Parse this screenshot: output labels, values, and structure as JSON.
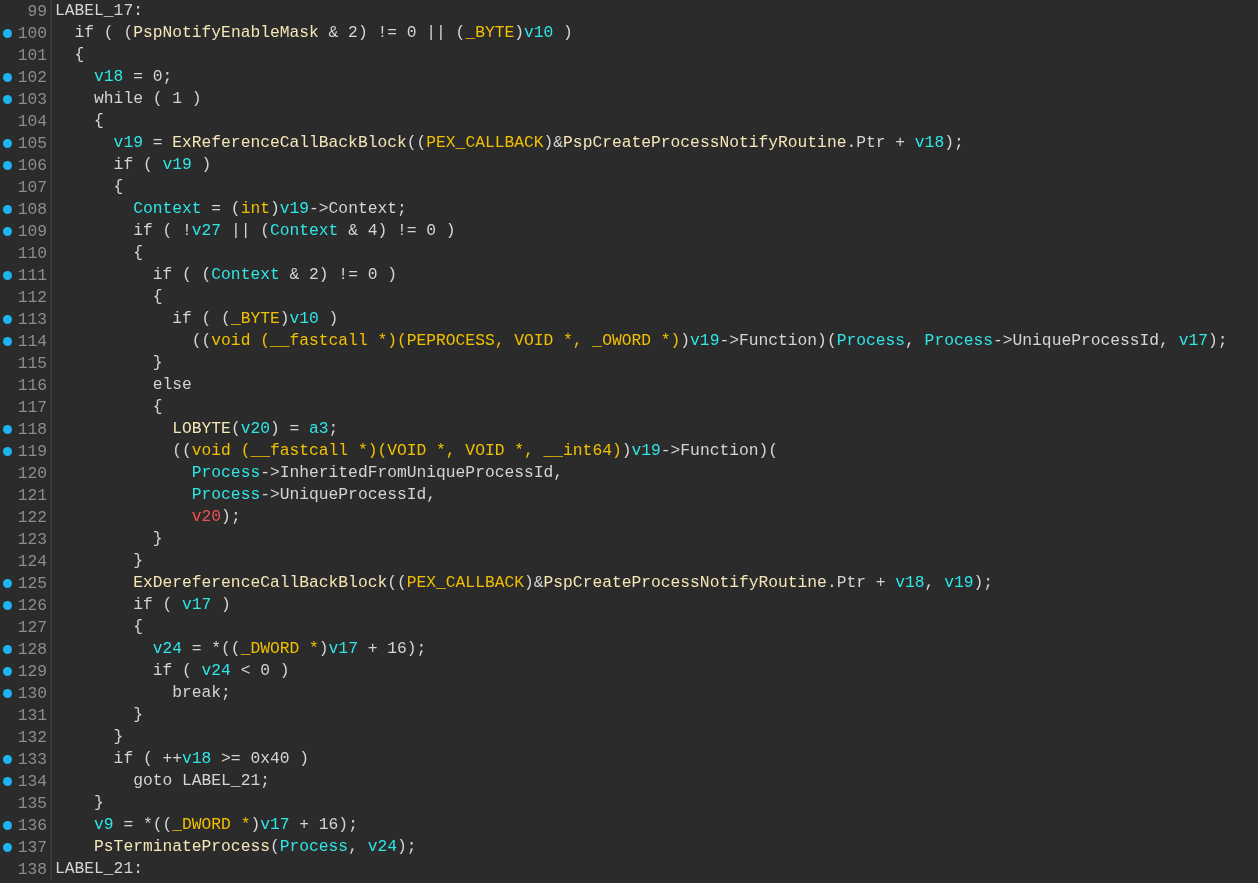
{
  "lines": [
    {
      "number": "99",
      "marked": false,
      "tokens": [
        {
          "kind": "plain",
          "text": "LABEL_17:"
        }
      ]
    },
    {
      "number": "100",
      "marked": true,
      "tokens": [
        {
          "kind": "plain",
          "text": "  if ( ("
        },
        {
          "kind": "func",
          "text": "PspNotifyEnableMask"
        },
        {
          "kind": "plain",
          "text": " & 2) != 0 || ("
        },
        {
          "kind": "type",
          "text": "_BYTE"
        },
        {
          "kind": "plain",
          "text": ")"
        },
        {
          "kind": "var",
          "text": "v10"
        },
        {
          "kind": "plain",
          "text": " )"
        }
      ]
    },
    {
      "number": "101",
      "marked": false,
      "tokens": [
        {
          "kind": "plain",
          "text": "  {"
        }
      ]
    },
    {
      "number": "102",
      "marked": true,
      "tokens": [
        {
          "kind": "var",
          "text": "    v18"
        },
        {
          "kind": "plain",
          "text": " = 0;"
        }
      ]
    },
    {
      "number": "103",
      "marked": true,
      "tokens": [
        {
          "kind": "plain",
          "text": "    while ( 1 )"
        }
      ]
    },
    {
      "number": "104",
      "marked": false,
      "tokens": [
        {
          "kind": "plain",
          "text": "    {"
        }
      ]
    },
    {
      "number": "105",
      "marked": true,
      "tokens": [
        {
          "kind": "var",
          "text": "      v19"
        },
        {
          "kind": "plain",
          "text": " = "
        },
        {
          "kind": "func",
          "text": "ExReferenceCallBackBlock"
        },
        {
          "kind": "plain",
          "text": "(("
        },
        {
          "kind": "type",
          "text": "PEX_CALLBACK"
        },
        {
          "kind": "plain",
          "text": ")&"
        },
        {
          "kind": "func",
          "text": "PspCreateProcessNotifyRoutine"
        },
        {
          "kind": "plain",
          "text": ".Ptr + "
        },
        {
          "kind": "var",
          "text": "v18"
        },
        {
          "kind": "plain",
          "text": ");"
        }
      ]
    },
    {
      "number": "106",
      "marked": true,
      "tokens": [
        {
          "kind": "plain",
          "text": "      if ( "
        },
        {
          "kind": "var",
          "text": "v19"
        },
        {
          "kind": "plain",
          "text": " )"
        }
      ]
    },
    {
      "number": "107",
      "marked": false,
      "tokens": [
        {
          "kind": "plain",
          "text": "      {"
        }
      ]
    },
    {
      "number": "108",
      "marked": true,
      "tokens": [
        {
          "kind": "var",
          "text": "        Context"
        },
        {
          "kind": "plain",
          "text": " = ("
        },
        {
          "kind": "type",
          "text": "int"
        },
        {
          "kind": "plain",
          "text": ")"
        },
        {
          "kind": "var",
          "text": "v19"
        },
        {
          "kind": "plain",
          "text": "->Context;"
        }
      ]
    },
    {
      "number": "109",
      "marked": true,
      "tokens": [
        {
          "kind": "plain",
          "text": "        if ( !"
        },
        {
          "kind": "var",
          "text": "v27"
        },
        {
          "kind": "plain",
          "text": " || ("
        },
        {
          "kind": "var",
          "text": "Context"
        },
        {
          "kind": "plain",
          "text": " & 4) != 0 )"
        }
      ]
    },
    {
      "number": "110",
      "marked": false,
      "tokens": [
        {
          "kind": "plain",
          "text": "        {"
        }
      ]
    },
    {
      "number": "111",
      "marked": true,
      "tokens": [
        {
          "kind": "plain",
          "text": "          if ( ("
        },
        {
          "kind": "var",
          "text": "Context"
        },
        {
          "kind": "plain",
          "text": " & 2) != 0 )"
        }
      ]
    },
    {
      "number": "112",
      "marked": false,
      "tokens": [
        {
          "kind": "plain",
          "text": "          {"
        }
      ]
    },
    {
      "number": "113",
      "marked": true,
      "tokens": [
        {
          "kind": "plain",
          "text": "            if ( ("
        },
        {
          "kind": "type",
          "text": "_BYTE"
        },
        {
          "kind": "plain",
          "text": ")"
        },
        {
          "kind": "var",
          "text": "v10"
        },
        {
          "kind": "plain",
          "text": " )"
        }
      ]
    },
    {
      "number": "114",
      "marked": true,
      "tokens": [
        {
          "kind": "plain",
          "text": "              (("
        },
        {
          "kind": "type",
          "text": "void (__fastcall *)(PEPROCESS, VOID *, _OWORD *)"
        },
        {
          "kind": "plain",
          "text": ")"
        },
        {
          "kind": "var",
          "text": "v19"
        },
        {
          "kind": "plain",
          "text": "->Function)("
        },
        {
          "kind": "var",
          "text": "Process"
        },
        {
          "kind": "plain",
          "text": ", "
        },
        {
          "kind": "var",
          "text": "Process"
        },
        {
          "kind": "plain",
          "text": "->UniqueProcessId, "
        },
        {
          "kind": "var",
          "text": "v17"
        },
        {
          "kind": "plain",
          "text": ");"
        }
      ]
    },
    {
      "number": "115",
      "marked": false,
      "tokens": [
        {
          "kind": "plain",
          "text": "          }"
        }
      ]
    },
    {
      "number": "116",
      "marked": false,
      "tokens": [
        {
          "kind": "plain",
          "text": "          else"
        }
      ]
    },
    {
      "number": "117",
      "marked": false,
      "tokens": [
        {
          "kind": "plain",
          "text": "          {"
        }
      ]
    },
    {
      "number": "118",
      "marked": true,
      "tokens": [
        {
          "kind": "func",
          "text": "            LOBYTE"
        },
        {
          "kind": "plain",
          "text": "("
        },
        {
          "kind": "var",
          "text": "v20"
        },
        {
          "kind": "plain",
          "text": ") = "
        },
        {
          "kind": "var",
          "text": "a3"
        },
        {
          "kind": "plain",
          "text": ";"
        }
      ]
    },
    {
      "number": "119",
      "marked": true,
      "tokens": [
        {
          "kind": "plain",
          "text": "            (("
        },
        {
          "kind": "type",
          "text": "void (__fastcall *)(VOID *, VOID *, __int64)"
        },
        {
          "kind": "plain",
          "text": ")"
        },
        {
          "kind": "var",
          "text": "v19"
        },
        {
          "kind": "plain",
          "text": "->Function)("
        }
      ]
    },
    {
      "number": "120",
      "marked": false,
      "tokens": [
        {
          "kind": "var",
          "text": "              Process"
        },
        {
          "kind": "plain",
          "text": "->InheritedFromUniqueProcessId,"
        }
      ]
    },
    {
      "number": "121",
      "marked": false,
      "tokens": [
        {
          "kind": "var",
          "text": "              Process"
        },
        {
          "kind": "plain",
          "text": "->UniqueProcessId,"
        }
      ]
    },
    {
      "number": "122",
      "marked": false,
      "tokens": [
        {
          "kind": "warn",
          "text": "              v20"
        },
        {
          "kind": "plain",
          "text": ");"
        }
      ]
    },
    {
      "number": "123",
      "marked": false,
      "tokens": [
        {
          "kind": "plain",
          "text": "          }"
        }
      ]
    },
    {
      "number": "124",
      "marked": false,
      "tokens": [
        {
          "kind": "plain",
          "text": "        }"
        }
      ]
    },
    {
      "number": "125",
      "marked": true,
      "tokens": [
        {
          "kind": "func",
          "text": "        ExDereferenceCallBackBlock"
        },
        {
          "kind": "plain",
          "text": "(("
        },
        {
          "kind": "type",
          "text": "PEX_CALLBACK"
        },
        {
          "kind": "plain",
          "text": ")&"
        },
        {
          "kind": "func",
          "text": "PspCreateProcessNotifyRoutine"
        },
        {
          "kind": "plain",
          "text": ".Ptr + "
        },
        {
          "kind": "var",
          "text": "v18"
        },
        {
          "kind": "plain",
          "text": ", "
        },
        {
          "kind": "var",
          "text": "v19"
        },
        {
          "kind": "plain",
          "text": ");"
        }
      ]
    },
    {
      "number": "126",
      "marked": true,
      "tokens": [
        {
          "kind": "plain",
          "text": "        if ( "
        },
        {
          "kind": "var",
          "text": "v17"
        },
        {
          "kind": "plain",
          "text": " )"
        }
      ]
    },
    {
      "number": "127",
      "marked": false,
      "tokens": [
        {
          "kind": "plain",
          "text": "        {"
        }
      ]
    },
    {
      "number": "128",
      "marked": true,
      "tokens": [
        {
          "kind": "var",
          "text": "          v24"
        },
        {
          "kind": "plain",
          "text": " = *(("
        },
        {
          "kind": "type",
          "text": "_DWORD *"
        },
        {
          "kind": "plain",
          "text": ")"
        },
        {
          "kind": "var",
          "text": "v17"
        },
        {
          "kind": "plain",
          "text": " + 16);"
        }
      ]
    },
    {
      "number": "129",
      "marked": true,
      "tokens": [
        {
          "kind": "plain",
          "text": "          if ( "
        },
        {
          "kind": "var",
          "text": "v24"
        },
        {
          "kind": "plain",
          "text": " < 0 )"
        }
      ]
    },
    {
      "number": "130",
      "marked": true,
      "tokens": [
        {
          "kind": "plain",
          "text": "            break;"
        }
      ]
    },
    {
      "number": "131",
      "marked": false,
      "tokens": [
        {
          "kind": "plain",
          "text": "        }"
        }
      ]
    },
    {
      "number": "132",
      "marked": false,
      "tokens": [
        {
          "kind": "plain",
          "text": "      }"
        }
      ]
    },
    {
      "number": "133",
      "marked": true,
      "tokens": [
        {
          "kind": "plain",
          "text": "      if ( ++"
        },
        {
          "kind": "var",
          "text": "v18"
        },
        {
          "kind": "plain",
          "text": " >= 0x40 )"
        }
      ]
    },
    {
      "number": "134",
      "marked": true,
      "tokens": [
        {
          "kind": "plain",
          "text": "        goto LABEL_21;"
        }
      ]
    },
    {
      "number": "135",
      "marked": false,
      "tokens": [
        {
          "kind": "plain",
          "text": "    }"
        }
      ]
    },
    {
      "number": "136",
      "marked": true,
      "tokens": [
        {
          "kind": "var",
          "text": "    v9"
        },
        {
          "kind": "plain",
          "text": " = *(("
        },
        {
          "kind": "type",
          "text": "_DWORD *"
        },
        {
          "kind": "plain",
          "text": ")"
        },
        {
          "kind": "var",
          "text": "v17"
        },
        {
          "kind": "plain",
          "text": " + 16);"
        }
      ]
    },
    {
      "number": "137",
      "marked": true,
      "tokens": [
        {
          "kind": "func",
          "text": "    PsTerminateProcess"
        },
        {
          "kind": "plain",
          "text": "("
        },
        {
          "kind": "var",
          "text": "Process"
        },
        {
          "kind": "plain",
          "text": ", "
        },
        {
          "kind": "var",
          "text": "v24"
        },
        {
          "kind": "plain",
          "text": ");"
        }
      ]
    },
    {
      "number": "138",
      "marked": false,
      "tokens": [
        {
          "kind": "plain",
          "text": "LABEL_21:"
        }
      ]
    }
  ]
}
